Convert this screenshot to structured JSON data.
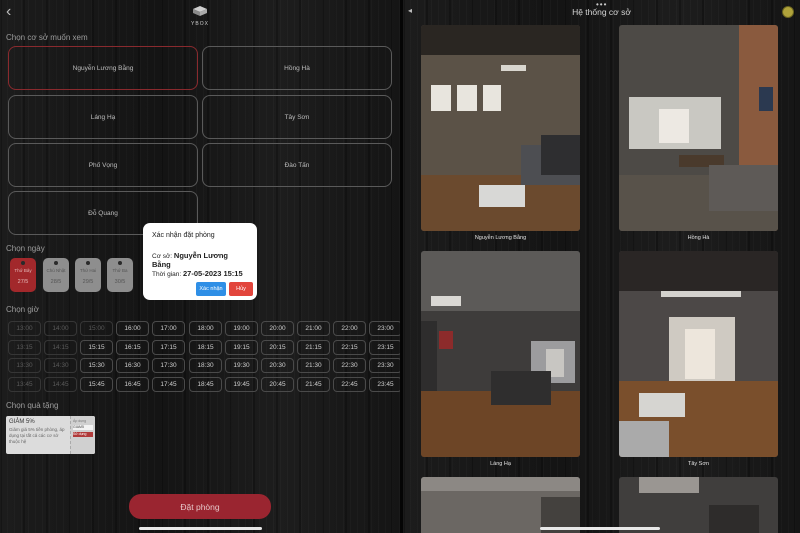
{
  "left": {
    "logo_text": "YBOX",
    "section_branch": "Chọn cơ sở muốn xem",
    "branches": [
      {
        "label": "Nguyễn Lương Bằng",
        "selected": true
      },
      {
        "label": "Hồng Hà",
        "selected": false
      },
      {
        "label": "Láng Hạ",
        "selected": false
      },
      {
        "label": "Tây Sơn",
        "selected": false
      },
      {
        "label": "Phố Vọng",
        "selected": false
      },
      {
        "label": "Đào Tấn",
        "selected": false
      },
      {
        "label": "Đỗ Quang",
        "selected": false
      }
    ],
    "section_day": "Chọn ngày",
    "days": [
      {
        "weekday": "Thứ Bảy",
        "date": "27/5",
        "selected": true
      },
      {
        "weekday": "Chủ Nhật",
        "date": "28/5",
        "selected": false
      },
      {
        "weekday": "Thứ Hai",
        "date": "29/5",
        "selected": false
      },
      {
        "weekday": "Thứ Ba",
        "date": "30/5",
        "selected": false
      }
    ],
    "section_time": "Chọn giờ",
    "time_rows": [
      [
        "13:00",
        "14:00",
        "15:00",
        "16:00",
        "17:00",
        "18:00",
        "19:00",
        "20:00",
        "21:00",
        "22:00",
        "23:00"
      ],
      [
        "13:15",
        "14:15",
        "15:15",
        "16:15",
        "17:15",
        "18:15",
        "19:15",
        "20:15",
        "21:15",
        "22:15",
        "23:15"
      ],
      [
        "13:30",
        "14:30",
        "15:30",
        "16:30",
        "17:30",
        "18:30",
        "19:30",
        "20:30",
        "21:30",
        "22:30",
        "23:30"
      ],
      [
        "13:45",
        "14:45",
        "15:45",
        "16:45",
        "17:45",
        "18:45",
        "19:45",
        "20:45",
        "21:45",
        "22:45",
        "23:45"
      ]
    ],
    "section_gift": "Chọn quà tặng",
    "gift": {
      "title": "GIẢM 5%",
      "description": "Giảm giá 5% tiền phòng, áp dụng tại tất cả các cơ sở thuộc hệ",
      "right_label": "Áp dụng",
      "code": "GIAM5",
      "use_label": "Sử dụng"
    },
    "book_button": "Đặt phòng"
  },
  "dialog": {
    "title": "Xác nhận đặt phòng",
    "branch_label": "Cơ sở:",
    "branch_value": "Nguyễn Lương Bằng",
    "time_label": "Thời gian:",
    "time_value": "27-05-2023 15:15",
    "confirm": "Xác nhận",
    "cancel": "Hủy",
    "confirm_color": "#2f8fe6",
    "cancel_color": "#e2453c"
  },
  "right": {
    "title": "Hệ thống cơ sở",
    "photos": [
      {
        "caption": "Nguyễn Lương Bằng"
      },
      {
        "caption": "Hồng Hà"
      },
      {
        "caption": "Láng Hạ"
      },
      {
        "caption": "Tây Sơn"
      }
    ]
  },
  "colors": {
    "accent": "#9a2530",
    "selected_border": "#8a2a2e"
  }
}
